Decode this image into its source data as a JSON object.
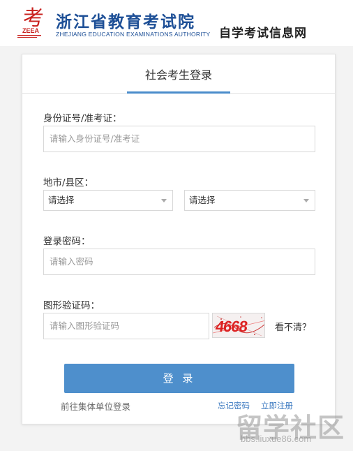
{
  "header": {
    "org_name": "浙江省教育考试院",
    "org_en": "ZHEJIANG EDUCATION EXAMINATIONS AUTHORITY",
    "logo_text": "ZEEA",
    "logo_char": "考",
    "site_name": "自学考试信息网",
    "brand_color": "#1d4f96"
  },
  "card": {
    "tab_title": "社会考生登录",
    "id_label": "身份证号/准考证：",
    "id_placeholder": "请输入身份证号/准考证",
    "region_label": "地市/县区：",
    "city_select": "请选择",
    "county_select": "请选择",
    "password_label": "登录密码：",
    "password_placeholder": "请输入密码",
    "captcha_label": "图形验证码：",
    "captcha_placeholder": "请输入图形验证码",
    "captcha_value": "4668",
    "refresh_label": "看不清？",
    "login_button": "登 录",
    "group_login_link": "前往集体单位登录",
    "forgot_link": "忘记密码",
    "register_link": "立即注册",
    "accent_color": "#4e8fcc"
  },
  "watermark": {
    "title": "留学社区",
    "url": "bbs.liuxue86.com"
  }
}
